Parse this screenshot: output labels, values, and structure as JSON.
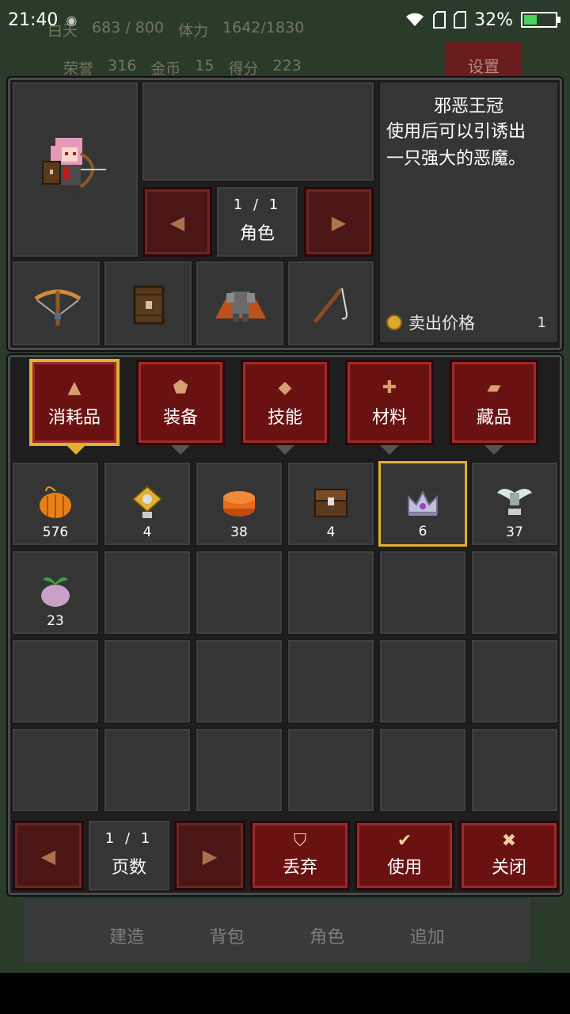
{
  "status_bar": {
    "time": "21:40",
    "battery": "32%"
  },
  "hud": {
    "day_label": "白天",
    "day_value": "683 / 800",
    "stamina_label": "体力",
    "stamina_value": "1642/1830",
    "honor_label": "荣誉",
    "honor_value": "316",
    "gold_label": "金币",
    "gold_value": "15",
    "score_label": "得分",
    "score_value": "223",
    "settings_label": "设置"
  },
  "bottom_nav": [
    "建造",
    "背包",
    "角色",
    "追加"
  ],
  "character_pager": {
    "page": "1 / 1",
    "label": "角色"
  },
  "item_detail": {
    "name": "邪恶王冠",
    "description_lines": [
      "使用后可以引诱出",
      "一只强大的恶魔。"
    ],
    "sell_label": "卖出价格",
    "sell_value": "1"
  },
  "equipment_slots": [
    "crossbow-icon",
    "shield-icon",
    "armor-icon",
    "fishing-rod-icon"
  ],
  "tabs": [
    {
      "label": "消耗品",
      "icon": "flask-icon",
      "glyph": "▲",
      "active": true
    },
    {
      "label": "装备",
      "icon": "shield-icon",
      "glyph": "⬟",
      "active": false
    },
    {
      "label": "技能",
      "icon": "diamond-icon",
      "glyph": "◆",
      "active": false
    },
    {
      "label": "材料",
      "icon": "plus-icon",
      "glyph": "✚",
      "active": false
    },
    {
      "label": "藏品",
      "icon": "scroll-icon",
      "glyph": "▰",
      "active": false
    }
  ],
  "items": [
    {
      "icon": "pumpkin-icon",
      "count": "576",
      "color": "#e8801a"
    },
    {
      "icon": "gem-token-icon",
      "count": "4",
      "color": "#e0b030"
    },
    {
      "icon": "cake-icon",
      "count": "38",
      "color": "#e86a1a"
    },
    {
      "icon": "chest-icon",
      "count": "4",
      "color": "#7a4a24"
    },
    {
      "icon": "crown-icon",
      "count": "6",
      "color": "#c0c0d8",
      "selected": true
    },
    {
      "icon": "winged-token-icon",
      "count": "37",
      "color": "#d8e8e8"
    },
    {
      "icon": "turnip-icon",
      "count": "23",
      "color": "#c8a0c8"
    }
  ],
  "inventory_pager": {
    "page": "1 / 1",
    "label": "页数"
  },
  "actions": {
    "discard_label": "丢弃",
    "use_label": "使用",
    "close_label": "关闭"
  }
}
